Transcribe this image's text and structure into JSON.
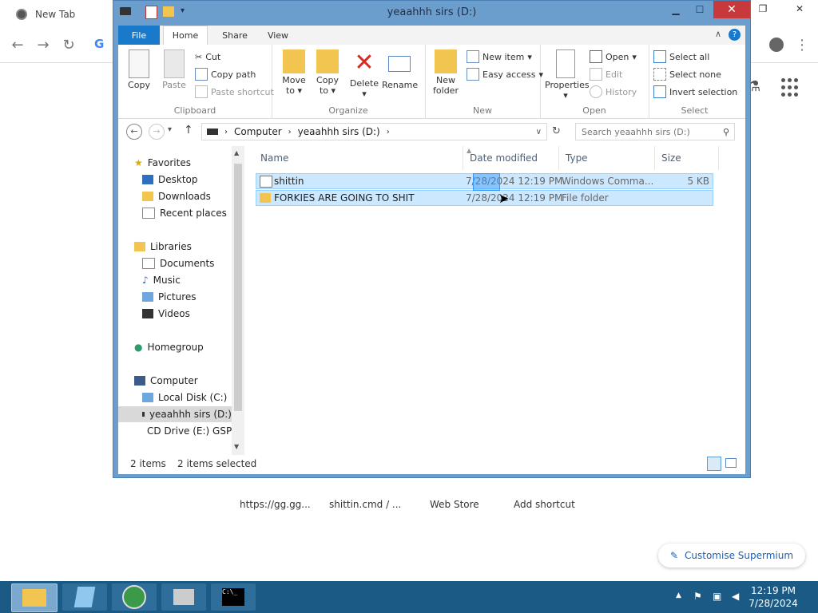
{
  "browser": {
    "tab_title": "New Tab",
    "shortcuts": [
      "https://gg.gg...",
      "shittin.cmd / ...",
      "Web Store",
      "Add shortcut"
    ],
    "customise_label": "Customise Supermium"
  },
  "explorer": {
    "title": "yeaahhh sirs (D:)",
    "ribbon_tabs": [
      "File",
      "Home",
      "Share",
      "View"
    ],
    "clipboard": {
      "copy": "Copy",
      "paste": "Paste",
      "cut": "Cut",
      "copy_path": "Copy path",
      "paste_shortcut": "Paste shortcut",
      "label": "Clipboard"
    },
    "organize": {
      "move_to": "Move",
      "move_to2": "to",
      "copy_to": "Copy",
      "copy_to2": "to",
      "delete": "Delete",
      "rename": "Rename",
      "label": "Organize"
    },
    "new": {
      "new_folder": "New",
      "new_folder2": "folder",
      "new_item": "New item",
      "easy_access": "Easy access",
      "label": "New"
    },
    "open": {
      "properties": "Properties",
      "open": "Open",
      "edit": "Edit",
      "history": "History",
      "label": "Open"
    },
    "select": {
      "select_all": "Select all",
      "select_none": "Select none",
      "invert": "Invert selection",
      "label": "Select"
    },
    "address": {
      "crumbs": [
        "Computer",
        "yeaahhh sirs (D:)"
      ]
    },
    "search_placeholder": "Search yeaahhh sirs (D:)",
    "nav": {
      "favorites": "Favorites",
      "desktop": "Desktop",
      "downloads": "Downloads",
      "recent": "Recent places",
      "libraries": "Libraries",
      "documents": "Documents",
      "music": "Music",
      "pictures": "Pictures",
      "videos": "Videos",
      "homegroup": "Homegroup",
      "computer": "Computer",
      "local_disk": "Local Disk (C:)",
      "drive_d": "yeaahhh sirs (D:)",
      "cd_drive": "CD Drive (E:) GSP"
    },
    "columns": [
      "Name",
      "Date modified",
      "Type",
      "Size"
    ],
    "files": [
      {
        "name": "shittin",
        "date": "7/28/2024 12:19 PM",
        "type": "Windows Comma...",
        "size": "5 KB"
      },
      {
        "name": "FORKIES ARE GOING TO SHIT",
        "date": "7/28/2024 12:19 PM",
        "type": "File folder",
        "size": ""
      }
    ],
    "status": {
      "items": "2 items",
      "selected": "2 items selected"
    }
  },
  "taskbar": {
    "time": "12:19 PM",
    "date": "7/28/2024"
  },
  "colors": {
    "ribbon_file_tab": "#1979ca",
    "selection_fill": "#cce8ff",
    "selection_border": "#99d1ff",
    "taskbar": "#1c5a86"
  }
}
